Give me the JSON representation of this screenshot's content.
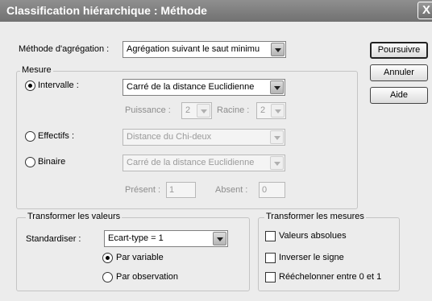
{
  "window": {
    "title": "Classification hiérarchique : Méthode",
    "close_glyph": "X"
  },
  "methode": {
    "label": "Méthode d'agrégation :",
    "value": "Agrégation suivant le saut minimu"
  },
  "buttons": {
    "poursuivre": "Poursuivre",
    "annuler": "Annuler",
    "aide": "Aide"
  },
  "mesure": {
    "title": "Mesure",
    "intervalle": {
      "label": "Intervalle :",
      "value": "Carré de la distance Euclidienne",
      "checked": true
    },
    "puissance": {
      "label": "Puissance :",
      "value": "2"
    },
    "racine": {
      "label": "Racine :",
      "value": "2"
    },
    "effectifs": {
      "label": "Effectifs :",
      "value": "Distance du Chi-deux",
      "checked": false
    },
    "binaire": {
      "label": "Binaire",
      "value": "Carré de la distance Euclidienne",
      "checked": false
    },
    "present": {
      "label": "Présent :",
      "value": "1"
    },
    "absent": {
      "label": "Absent :",
      "value": "0"
    }
  },
  "transformer_valeurs": {
    "title": "Transformer les valeurs",
    "standardiser_label": "Standardiser :",
    "standardiser_value": "Ecart-type = 1",
    "par_variable": "Par variable",
    "par_observation": "Par observation",
    "selected": "par_variable"
  },
  "transformer_mesures": {
    "title": "Transformer les mesures",
    "valeurs_absolues": "Valeurs absolues",
    "inverser_signe": "Inverser le signe",
    "reechelonner": "Rééchelonner entre 0 et 1"
  }
}
